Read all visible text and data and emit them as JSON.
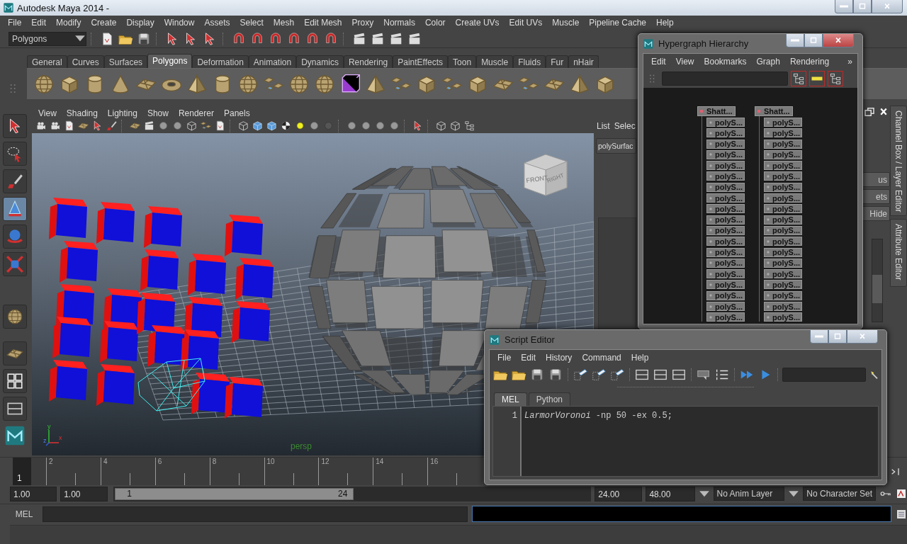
{
  "window": {
    "title": "Autodesk Maya 2014 -"
  },
  "menu_bar": [
    "File",
    "Edit",
    "Modify",
    "Create",
    "Display",
    "Window",
    "Assets",
    "Select",
    "Mesh",
    "Edit Mesh",
    "Proxy",
    "Normals",
    "Color",
    "Create UVs",
    "Edit UVs",
    "Muscle",
    "Pipeline Cache",
    "Help"
  ],
  "status_line": {
    "menu_set": "Polygons"
  },
  "shelf": {
    "tabs": [
      {
        "label": "General",
        "selected": false
      },
      {
        "label": "Curves",
        "selected": false
      },
      {
        "label": "Surfaces",
        "selected": false
      },
      {
        "label": "Polygons",
        "selected": true
      },
      {
        "label": "Deformation",
        "selected": false
      },
      {
        "label": "Animation",
        "selected": false
      },
      {
        "label": "Dynamics",
        "selected": false
      },
      {
        "label": "Rendering",
        "selected": false
      },
      {
        "label": "PaintEffects",
        "selected": false
      },
      {
        "label": "Toon",
        "selected": false
      },
      {
        "label": "Muscle",
        "selected": false
      },
      {
        "label": "Fluids",
        "selected": false
      },
      {
        "label": "Fur",
        "selected": false
      },
      {
        "label": "nHair",
        "selected": false
      }
    ]
  },
  "viewport": {
    "menu": [
      "View",
      "Shading",
      "Lighting",
      "Show",
      "Renderer",
      "Panels"
    ],
    "view_cube": {
      "front": "FRONT",
      "right": "RIGHT"
    },
    "axes": [
      "x",
      "y",
      "z"
    ],
    "camera": "persp"
  },
  "channel_box": {
    "menu": [
      "List",
      "Selec"
    ],
    "object": "polySurfac",
    "buttons": [
      "us",
      "ets",
      "Hide"
    ]
  },
  "side_tabs": [
    {
      "label": "Channel Box / Layer Editor"
    },
    {
      "label": "Attribute Editor"
    }
  ],
  "time_slider": {
    "current_frame": "1",
    "ticks": [
      "2",
      "4",
      "6",
      "8",
      "10",
      "12",
      "14",
      "16"
    ]
  },
  "range_slider": {
    "level": 0.5,
    "start": "1.00",
    "playback_start": "1.00",
    "range_start": "1",
    "range_end": "24",
    "playback_end": "24.00",
    "end": "48.00",
    "anim_layer": "No Anim Layer",
    "character_set": "No Character Set"
  },
  "command_line": {
    "language": "MEL"
  },
  "hypergraph": {
    "title": "Hypergraph Hierarchy",
    "menu": [
      "Edit",
      "View",
      "Bookmarks",
      "Graph",
      "Rendering"
    ],
    "more": "»",
    "columns": [
      {
        "label": "Shatt...",
        "children": [
          {
            "label": "polyS..."
          },
          {
            "label": "polyS..."
          },
          {
            "label": "polyS..."
          },
          {
            "label": "polyS..."
          },
          {
            "label": "polyS..."
          },
          {
            "label": "polyS..."
          },
          {
            "label": "polyS..."
          },
          {
            "label": "polyS..."
          },
          {
            "label": "polyS..."
          },
          {
            "label": "polyS..."
          },
          {
            "label": "polyS..."
          },
          {
            "label": "polyS..."
          },
          {
            "label": "polyS..."
          },
          {
            "label": "polyS..."
          },
          {
            "label": "polyS..."
          },
          {
            "label": "polyS..."
          },
          {
            "label": "polyS..."
          },
          {
            "label": "polyS..."
          },
          {
            "label": "polyS..."
          }
        ]
      },
      {
        "label": "Shatt...",
        "children": [
          {
            "label": "polyS..."
          },
          {
            "label": "polyS..."
          },
          {
            "label": "polyS..."
          },
          {
            "label": "polyS..."
          },
          {
            "label": "polyS..."
          },
          {
            "label": "polyS..."
          },
          {
            "label": "polyS..."
          },
          {
            "label": "polyS..."
          },
          {
            "label": "polyS..."
          },
          {
            "label": "polyS..."
          },
          {
            "label": "polyS..."
          },
          {
            "label": "polyS..."
          },
          {
            "label": "polyS..."
          },
          {
            "label": "polyS..."
          },
          {
            "label": "polyS..."
          },
          {
            "label": "polyS..."
          },
          {
            "label": "polyS..."
          },
          {
            "label": "polyS..."
          },
          {
            "label": "polyS..."
          }
        ]
      }
    ]
  },
  "script_editor": {
    "title": "Script Editor",
    "menu": [
      "File",
      "Edit",
      "History",
      "Command",
      "Help"
    ],
    "tabs": [
      {
        "label": "MEL",
        "selected": true
      },
      {
        "label": "Python",
        "selected": false
      }
    ],
    "lines": [
      {
        "number": "1",
        "code": "*LarmorVoronoi* -np 50 -ex 0.5;"
      }
    ]
  }
}
